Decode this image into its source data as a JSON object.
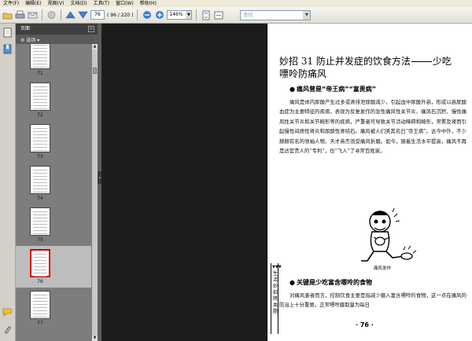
{
  "menu": [
    "文件(F)",
    "编辑(E)",
    "视图(V)",
    "文档(D)",
    "工具(T)",
    "窗口(W)",
    "帮助(H)"
  ],
  "toolbar": {
    "page_current": "76",
    "page_total": "( 96 / 220 )",
    "zoom": "146%",
    "search_placeholder": "查找"
  },
  "panel": {
    "title": "页面",
    "options_label": "选项"
  },
  "thumbnails": [
    {
      "label": "71",
      "selected": false
    },
    {
      "label": "72",
      "selected": false
    },
    {
      "label": "73",
      "selected": false
    },
    {
      "label": "74",
      "selected": false
    },
    {
      "label": "75",
      "selected": false
    },
    {
      "label": "76",
      "selected": true
    },
    {
      "label": "77",
      "selected": false
    }
  ],
  "document": {
    "title_part1": "妙招 31  防止并发症的饮食方法",
    "title_part2": "少吃",
    "title_line2": "嘌呤防痛风",
    "section1": "痛风曾是“帝王病”“富贵病”",
    "para1": "痛风是体内尿酸产生过多或肾排泄尿酸减少，引起血中尿酸升高，形成以高尿酸血症为主要特征的疾病，表现为反复发作的急性痛风性关节炎、痛风石沉积、慢性痛风性关节炎和关节畸形等的疾病，严重者可导致关节活动障碍和畸形，常累及肾而引起慢性间质性肾炎和尿酸性肾结石。痛风被人们美其名曰“帝王病”。古今中外，不少赫赫有名的领袖人物、天才英杰饱受痛风折磨。如今，随着生活水平提高，痛风不再是达官贵人的“专利”，也“飞入”了寻常百姓家。",
    "figure_caption": "痛风发作",
    "section2": "关键是少吃富含嘌呤的食物",
    "para2": "对痛风患者而言，控制饮食主要是指减少摄入富含嘌呤的食物，这一点在痛风的防治上十分重要。正常嘌呤摄取量为每日",
    "side_tab": "生活妙招降血脂",
    "side_arrows": "▼▼▼",
    "page_number": "· 76 ·"
  }
}
